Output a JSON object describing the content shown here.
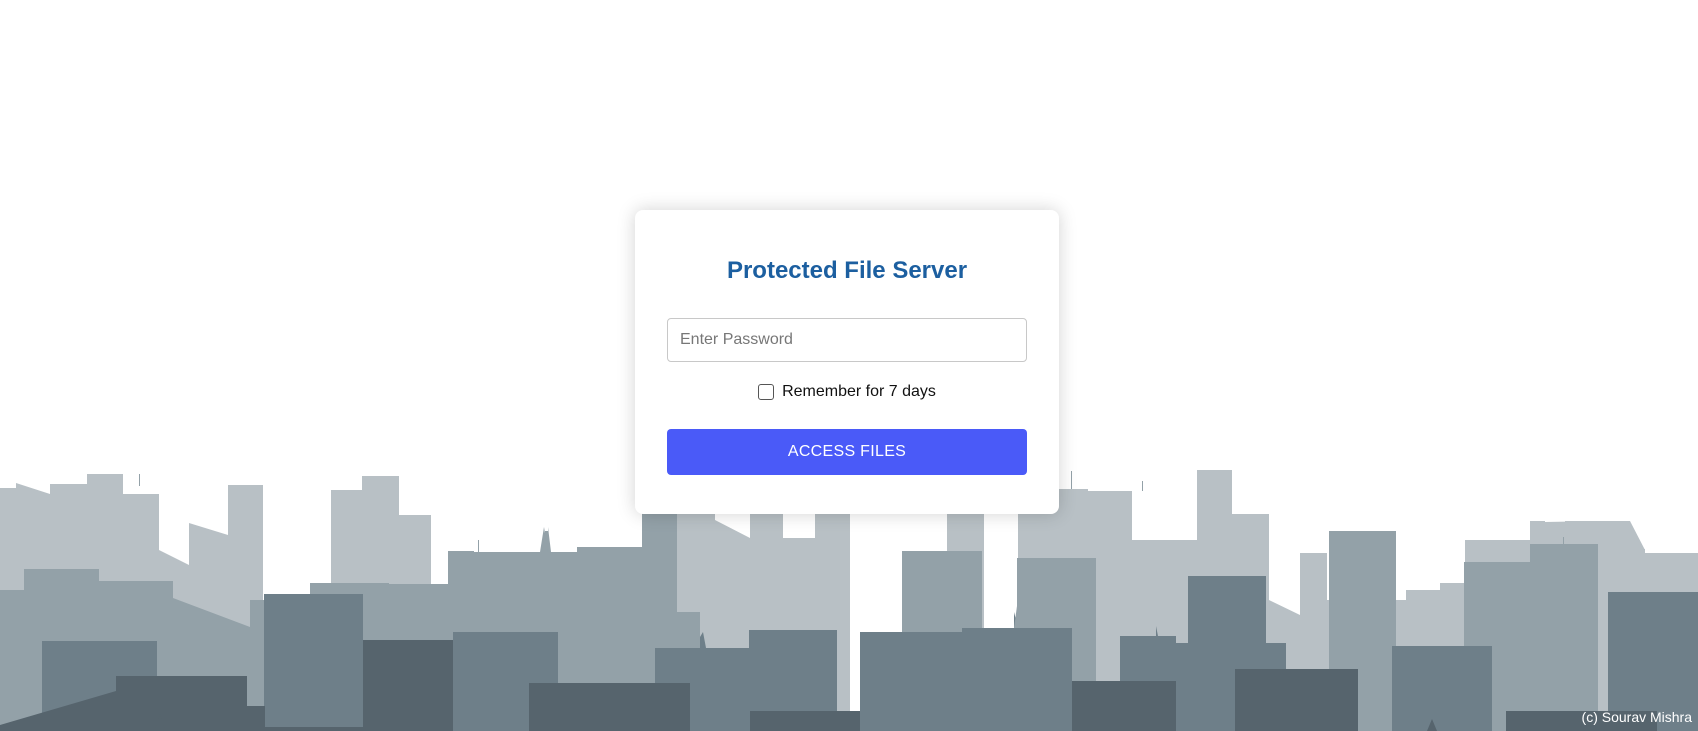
{
  "login": {
    "title": "Protected File Server",
    "password_placeholder": "Enter Password",
    "password_value": "",
    "remember_label": "Remember for 7 days",
    "remember_checked": false,
    "submit_label": "ACCESS FILES"
  },
  "footer": {
    "credit": "(c) Sourav Mishra"
  },
  "colors": {
    "title": "#1c5fa0",
    "button": "#4a5af8",
    "skyline_far": "#b8c0c5",
    "skyline_mid": "#93a1a8",
    "skyline_near": "#6e7f89",
    "skyline_front": "#4f5f69"
  },
  "icons": {
    "remember_checkbox": "checkbox-icon"
  }
}
